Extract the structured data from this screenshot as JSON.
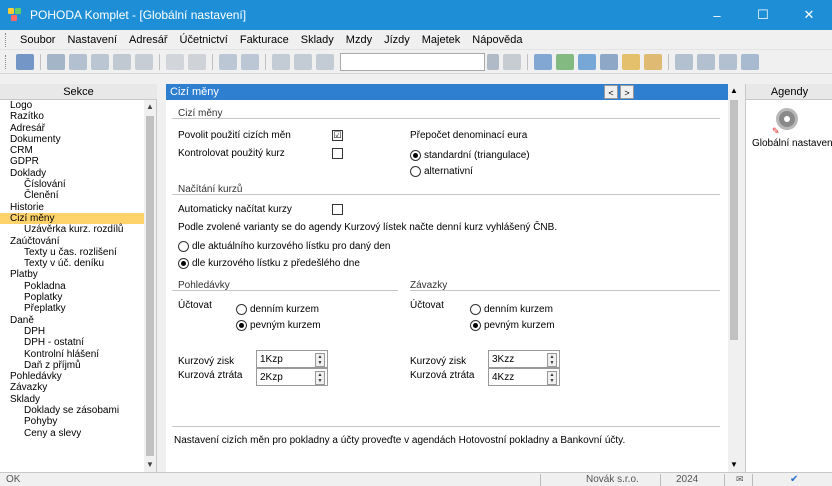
{
  "window": {
    "title": "POHODA Komplet - [Globální nastavení]",
    "min": "–",
    "max": "☐",
    "close": "✕"
  },
  "menu": [
    "Soubor",
    "Nastavení",
    "Adresář",
    "Účetnictví",
    "Fakturace",
    "Sklady",
    "Mzdy",
    "Jízdy",
    "Majetek",
    "Nápověda"
  ],
  "sections": {
    "header": "Sekce",
    "items": [
      {
        "label": "Logo",
        "sub": false
      },
      {
        "label": "Razítko",
        "sub": false
      },
      {
        "label": "Adresář",
        "sub": false
      },
      {
        "label": "Dokumenty",
        "sub": false
      },
      {
        "label": "CRM",
        "sub": false
      },
      {
        "label": "GDPR",
        "sub": false
      },
      {
        "label": "Doklady",
        "sub": false
      },
      {
        "label": "Číslování",
        "sub": true
      },
      {
        "label": "Členění",
        "sub": true
      },
      {
        "label": "Historie",
        "sub": false
      },
      {
        "label": "Cizí měny",
        "sub": false,
        "active": true
      },
      {
        "label": "Uzávěrka kurz. rozdílů",
        "sub": true
      },
      {
        "label": "Zaúčtování",
        "sub": false
      },
      {
        "label": "Texty u čas. rozlišení",
        "sub": true
      },
      {
        "label": "Texty v úč. deníku",
        "sub": true
      },
      {
        "label": "Platby",
        "sub": false
      },
      {
        "label": "Pokladna",
        "sub": true
      },
      {
        "label": "Poplatky",
        "sub": true
      },
      {
        "label": "Přeplatky",
        "sub": true
      },
      {
        "label": "Daně",
        "sub": false
      },
      {
        "label": "DPH",
        "sub": true
      },
      {
        "label": "DPH - ostatní",
        "sub": true
      },
      {
        "label": "Kontrolní hlášení",
        "sub": true
      },
      {
        "label": "Daň z příjmů",
        "sub": true
      },
      {
        "label": "Pohledávky",
        "sub": false
      },
      {
        "label": "Závazky",
        "sub": false
      },
      {
        "label": "Sklady",
        "sub": false
      },
      {
        "label": "Doklady se zásobami",
        "sub": true
      },
      {
        "label": "Pohyby",
        "sub": true
      },
      {
        "label": "Ceny a slevy",
        "sub": true
      }
    ]
  },
  "main": {
    "header": "Cizí měny",
    "nav_prev": "<",
    "nav_next": ">",
    "cizi_meny": {
      "title": "Cizí měny",
      "allow_label": "Povolit použití cizích měn",
      "allow_checked": "☑",
      "check_label": "Kontrolovat použitý kurz",
      "prepocet_title": "Přepočet denominací eura",
      "opt_standard": "standardní (triangulace)",
      "opt_alt": "alternativní"
    },
    "nacitani": {
      "title": "Načítání kurzů",
      "auto_label": "Automaticky načítat kurzy",
      "desc": "Podle zvolené varianty se do agendy Kurzový lístek načte denní kurz vyhlášený ČNB.",
      "opt_today": "dle aktuálního kurzového lístku pro daný den",
      "opt_prev": "dle kurzového lístku z předešlého dne"
    },
    "pohledavky": {
      "title": "Pohledávky",
      "uctovat": "Účtovat",
      "opt_daily": "denním kurzem",
      "opt_fixed": "pevným kurzem",
      "zisk_label": "Kurzový zisk",
      "zisk_value": "1Kzp",
      "ztrata_label": "Kurzová ztráta",
      "ztrata_value": "2Kzp"
    },
    "zavazky": {
      "title": "Závazky",
      "uctovat": "Účtovat",
      "opt_daily": "denním kurzem",
      "opt_fixed": "pevným kurzem",
      "zisk_label": "Kurzový zisk",
      "zisk_value": "3Kzz",
      "ztrata_label": "Kurzová ztráta",
      "ztrata_value": "4Kzz"
    },
    "note": "Nastavení cizích měn pro pokladny a účty proveďte v agendách Hotovostní pokladny a Bankovní účty."
  },
  "agendy": {
    "header": "Agendy",
    "item": "Globální nastavení"
  },
  "status": {
    "left": "OK",
    "company": "Novák s.r.o.",
    "year": "2024"
  },
  "colors": {
    "titlebar": "#1e8fd6",
    "main_header": "#2f7fd0",
    "active_item": "#ffd36b"
  }
}
